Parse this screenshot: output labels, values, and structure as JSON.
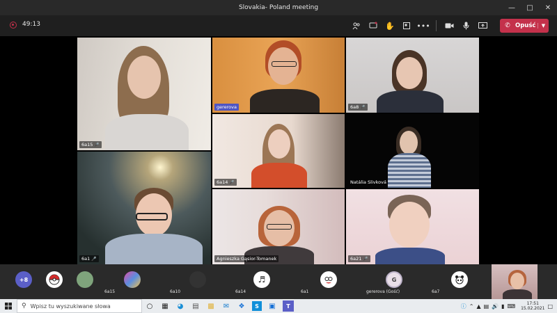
{
  "window": {
    "title": "Slovakia- Poland meeting"
  },
  "toolbar": {
    "timer": "49:13",
    "leave_label": "Opuść"
  },
  "tiles": {
    "t1": "6a15",
    "t2": "gererova",
    "t3": "6a8",
    "t4": "6a14",
    "t5": "Natália Slivková",
    "t6": "6a1",
    "t7": "Agnieszka Gąsior-Tomanek",
    "t8": "6a21"
  },
  "strip": {
    "overflow": "+8",
    "labels": [
      "6a15",
      "6a10",
      "6a14",
      "6a1",
      "gererova (Gość)",
      "6a7"
    ],
    "avatar_g": "G"
  },
  "taskbar": {
    "search_placeholder": "Wpisz tu wyszukiwane słowa",
    "time": "17:51",
    "date": "15.02.2021"
  },
  "colors": {
    "leave": "#c4314b",
    "teams_purple": "#5b5fc7"
  }
}
